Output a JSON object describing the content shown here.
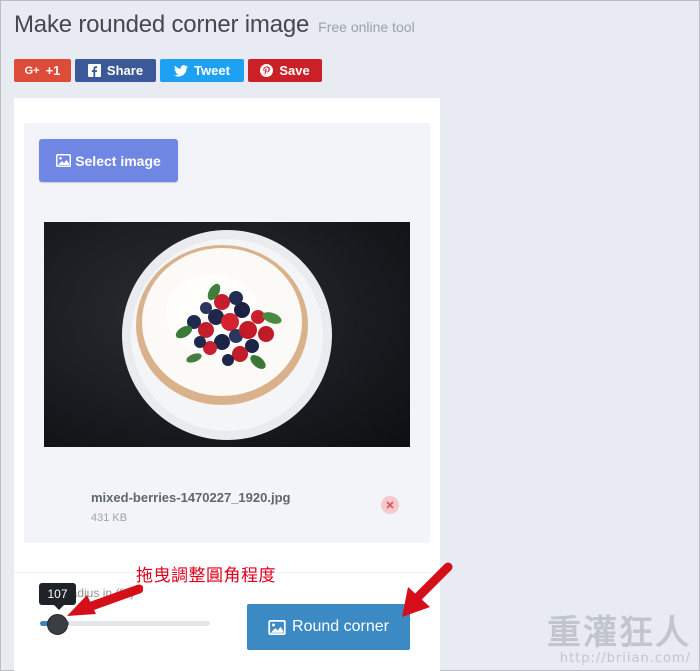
{
  "header": {
    "title": "Make rounded corner image",
    "subtitle": "Free online tool"
  },
  "social": [
    {
      "label": "+1",
      "icon": "google-plus-icon",
      "color": "#dd4b39"
    },
    {
      "label": "Share",
      "icon": "facebook-icon",
      "color": "#3b5998"
    },
    {
      "label": "Tweet",
      "icon": "twitter-icon",
      "color": "#1da1f2"
    },
    {
      "label": "Save",
      "icon": "pinterest-icon",
      "color": "#cb2027"
    }
  ],
  "upload": {
    "select_label": "Select image",
    "file_name": "mixed-berries-1470227_1920.jpg",
    "file_size": "431 KB"
  },
  "slider": {
    "label": "Radius in (%)",
    "value": "107",
    "fill_fraction": 0.17
  },
  "actions": {
    "round_label": "Round corner"
  },
  "annotation": {
    "text": "拖曳調整圓角程度"
  },
  "watermark": {
    "name": "重灌狂人",
    "url": "http://briian.com/"
  },
  "colors": {
    "accent": "#3b8ac4",
    "select_button": "#6f86e2",
    "annotation_red": "#e0001b"
  }
}
